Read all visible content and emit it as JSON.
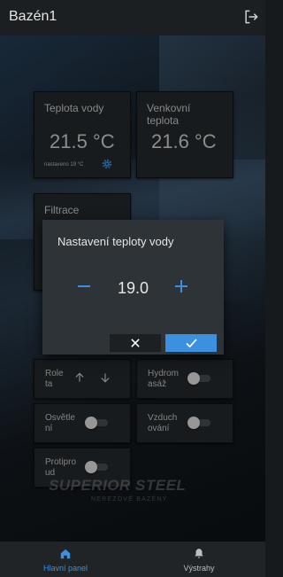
{
  "app": {
    "title": "Bazén1"
  },
  "cards": {
    "water_temp": {
      "label": "Teplota vody",
      "value": "21.5 °C",
      "setpoint": "nastaveno 19 °C"
    },
    "outside_temp": {
      "label_line1": "Venkovní",
      "label_line2": "teplota",
      "value": "21.6 °C"
    },
    "filtration": {
      "label": "Filtrace"
    }
  },
  "controls": {
    "roleta": {
      "label_line1": "Role",
      "label_line2": "ta"
    },
    "hydromasaz": {
      "label_line1": "Hydrom",
      "label_line2": "asáž",
      "state": false
    },
    "osvetleni": {
      "label_line1": "Osvětle",
      "label_line2": "ní",
      "state": false
    },
    "vzduchovani": {
      "label_line1": "Vzduch",
      "label_line2": "ování",
      "state": false
    },
    "protiproud": {
      "label_line1": "Protipro",
      "label_line2": "ud",
      "state": false
    }
  },
  "watermark": {
    "brand": "SUPERIOR STEEL",
    "sub": "NEREZOVÉ BAZÉNY"
  },
  "dialog": {
    "title": "Nastavení teploty vody",
    "value": "19.0"
  },
  "nav": {
    "home": {
      "label": "Hlavní panel",
      "icon": "home-icon",
      "color": "#3d8fe0"
    },
    "alerts": {
      "label": "Výstrahy",
      "icon": "bell-icon",
      "color": "#bdbdbd"
    }
  },
  "colors": {
    "accent": "#3d8fe0",
    "card": "#262a2d",
    "dialog": "#2d3337"
  }
}
